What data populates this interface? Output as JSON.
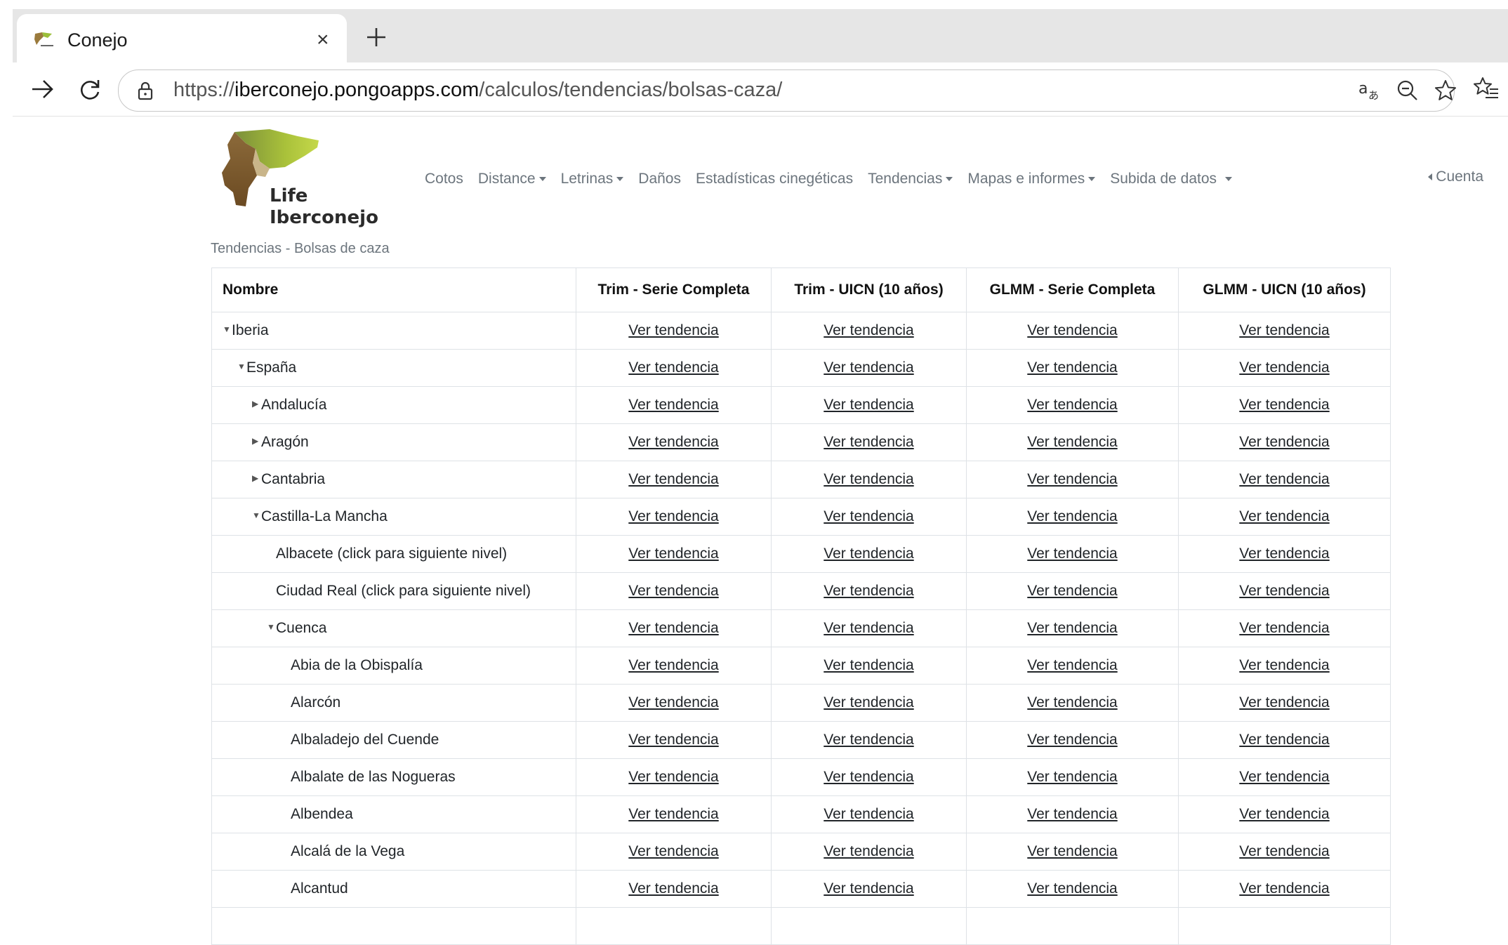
{
  "browser": {
    "tab_title": "Conejo",
    "tab_close": "×",
    "url_prefix": "https://",
    "url_host": "iberconejo.pongoapps.com",
    "url_path": "/calculos/tendencias/bolsas-caza/"
  },
  "site": {
    "logo_line1": "Life",
    "logo_line2": "Iberconejo",
    "nav": [
      {
        "label": "Cotos",
        "dropdown": false
      },
      {
        "label": "Distance",
        "dropdown": true
      },
      {
        "label": "Letrinas",
        "dropdown": true
      },
      {
        "label": "Daños",
        "dropdown": false
      },
      {
        "label": "Estadísticas cinegéticas",
        "dropdown": false
      },
      {
        "label": "Tendencias",
        "dropdown": true
      },
      {
        "label": "Mapas e informes",
        "dropdown": true
      },
      {
        "label": "Subida de datos",
        "dropdown": true
      }
    ],
    "account_label": "Cuenta",
    "breadcrumb": "Tendencias - Bolsas de caza"
  },
  "table": {
    "headers": [
      "Nombre",
      "Trim - Serie Completa",
      "Trim - UICN (10 años)",
      "GLMM - Serie Completa",
      "GLMM - UICN (10 años)"
    ],
    "link_label": "Ver tendencia",
    "rows": [
      {
        "name": "Iberia",
        "level": 0,
        "toggle": "down"
      },
      {
        "name": "España",
        "level": 1,
        "toggle": "down"
      },
      {
        "name": "Andalucía",
        "level": 2,
        "toggle": "right"
      },
      {
        "name": "Aragón",
        "level": 2,
        "toggle": "right"
      },
      {
        "name": "Cantabria",
        "level": 2,
        "toggle": "right"
      },
      {
        "name": "Castilla-La Mancha",
        "level": 2,
        "toggle": "down"
      },
      {
        "name": "Albacete (click para siguiente nivel)",
        "level": 3,
        "toggle": "none"
      },
      {
        "name": "Ciudad Real (click para siguiente nivel)",
        "level": 3,
        "toggle": "none"
      },
      {
        "name": "Cuenca",
        "level": 3,
        "toggle": "down"
      },
      {
        "name": "Abia de la Obispalía",
        "level": 4,
        "toggle": "none"
      },
      {
        "name": "Alarcón",
        "level": 4,
        "toggle": "none"
      },
      {
        "name": "Albaladejo del Cuende",
        "level": 4,
        "toggle": "none"
      },
      {
        "name": "Albalate de las Nogueras",
        "level": 4,
        "toggle": "none"
      },
      {
        "name": "Albendea",
        "level": 4,
        "toggle": "none"
      },
      {
        "name": "Alcalá de la Vega",
        "level": 4,
        "toggle": "none"
      },
      {
        "name": "Alcantud",
        "level": 4,
        "toggle": "none"
      },
      {
        "name": "",
        "level": 4,
        "toggle": "none"
      }
    ]
  }
}
